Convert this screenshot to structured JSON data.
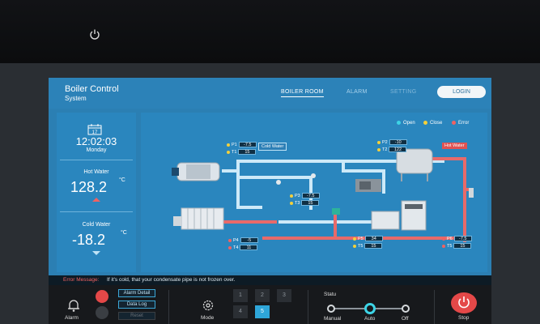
{
  "header": {
    "title": "Boiler Control",
    "subtitle": "System",
    "nav": [
      "BOILER ROOM",
      "ALARM",
      "SETTING"
    ],
    "login_label": "LOGIN"
  },
  "status_panel": {
    "calendar_day": "17",
    "time": "12:02:03",
    "day": "Monday",
    "hot_water": {
      "label": "Hot Water",
      "value": "128.2",
      "unit": "°C"
    },
    "cold_water": {
      "label": "Cold Water",
      "value": "-18.2",
      "unit": "°C"
    }
  },
  "legend": [
    {
      "label": "Open",
      "color": "#3dd4e6"
    },
    {
      "label": "Close",
      "color": "#f3d03b"
    },
    {
      "label": "Error",
      "color": "#f06262"
    }
  ],
  "readings": {
    "P1": "-7.5",
    "T1": "15",
    "P2": "-10",
    "T2": "122",
    "P3": "-7.5",
    "T3": "15",
    "P4": "-5",
    "T4": "11",
    "P5": "34",
    "T5": "15",
    "P6": "-7.5",
    "T6": "15"
  },
  "pipe_labels": {
    "cold": "Cold Water",
    "hot": "Hot Water"
  },
  "error": {
    "label": "Error Message:",
    "text": "If it's cold, that your condensate pipe is not frozen over."
  },
  "controls": {
    "alarm_label": "Alarm",
    "alarm_detail": "Alarm Detail",
    "data_log": "Data Log",
    "reset": "Reset",
    "mode_label": "Mode",
    "mode_buttons": [
      "1",
      "2",
      "3",
      "4",
      "5"
    ],
    "mode_selected": "5",
    "statu_label": "Statu",
    "switch_options": [
      "Manual",
      "Auto",
      "Off"
    ],
    "switch_selected": "Auto",
    "stop_label": "Stop"
  }
}
